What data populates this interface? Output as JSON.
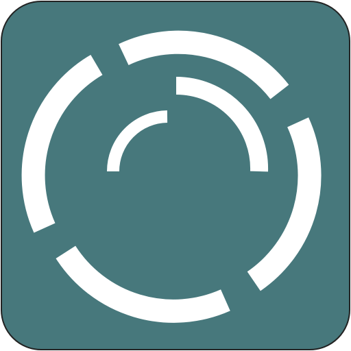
{
  "app_icon": {
    "icon": "concentric-arc-segments-icon",
    "colors": {
      "tile_background": "#47787c",
      "tile_border": "#222222",
      "arcs": "#ffffff",
      "page_background": "#ffffff"
    }
  }
}
